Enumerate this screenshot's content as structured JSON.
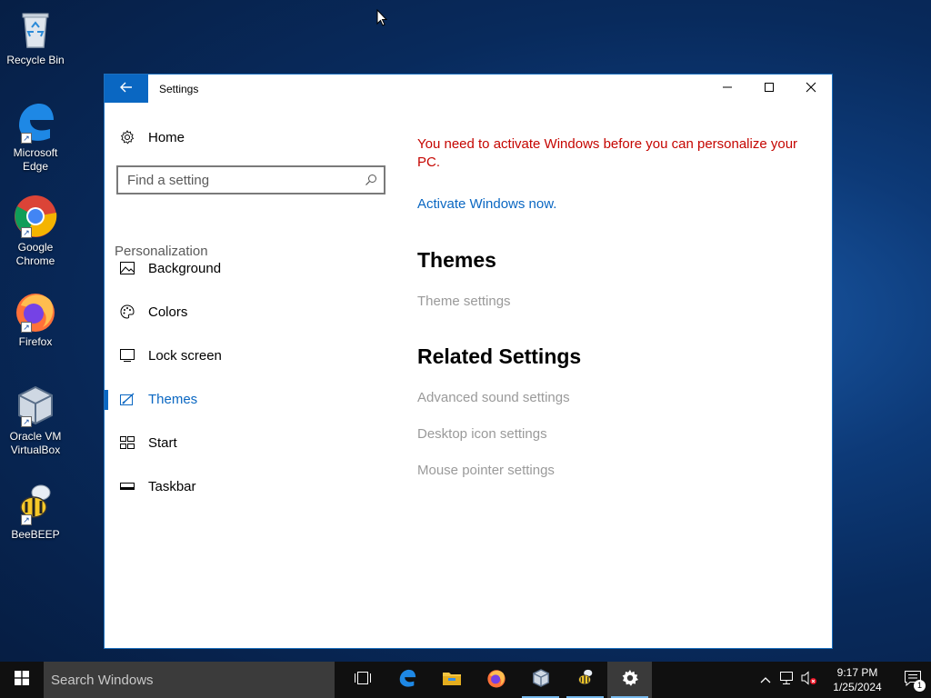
{
  "desktop": {
    "icons": [
      {
        "label": "Recycle Bin"
      },
      {
        "label": "Microsoft Edge"
      },
      {
        "label": "Google Chrome"
      },
      {
        "label": "Firefox"
      },
      {
        "label": "Oracle VM VirtualBox"
      },
      {
        "label": "BeeBEEP"
      }
    ]
  },
  "window": {
    "title": "Settings",
    "back_icon": "arrow-left-icon",
    "controls": [
      "minimize-icon",
      "maximize-icon",
      "close-icon"
    ]
  },
  "sidebar": {
    "home_label": "Home",
    "search_placeholder": "Find a setting",
    "section_label": "Personalization",
    "items": [
      {
        "label": "Background",
        "icon": "picture-icon",
        "active": false
      },
      {
        "label": "Colors",
        "icon": "palette-icon",
        "active": false
      },
      {
        "label": "Lock screen",
        "icon": "lock-screen-icon",
        "active": false
      },
      {
        "label": "Themes",
        "icon": "themes-brush-icon",
        "active": true
      },
      {
        "label": "Start",
        "icon": "start-tiles-icon",
        "active": false
      },
      {
        "label": "Taskbar",
        "icon": "taskbar-icon",
        "active": false
      }
    ]
  },
  "content": {
    "warning": "You need to activate Windows before you can personalize your PC.",
    "activate_link": "Activate Windows now.",
    "themes_heading": "Themes",
    "theme_settings_link": "Theme settings",
    "related_heading": "Related Settings",
    "related_links": [
      "Advanced sound settings",
      "Desktop icon settings",
      "Mouse pointer settings"
    ]
  },
  "taskbar": {
    "search_placeholder": "Search Windows",
    "clock_time": "9:17 PM",
    "clock_date": "1/25/2024",
    "notification_count": "1"
  },
  "colors": {
    "accent": "#0a67c2",
    "warning": "#c50500",
    "disabled": "#9a9a9a"
  }
}
